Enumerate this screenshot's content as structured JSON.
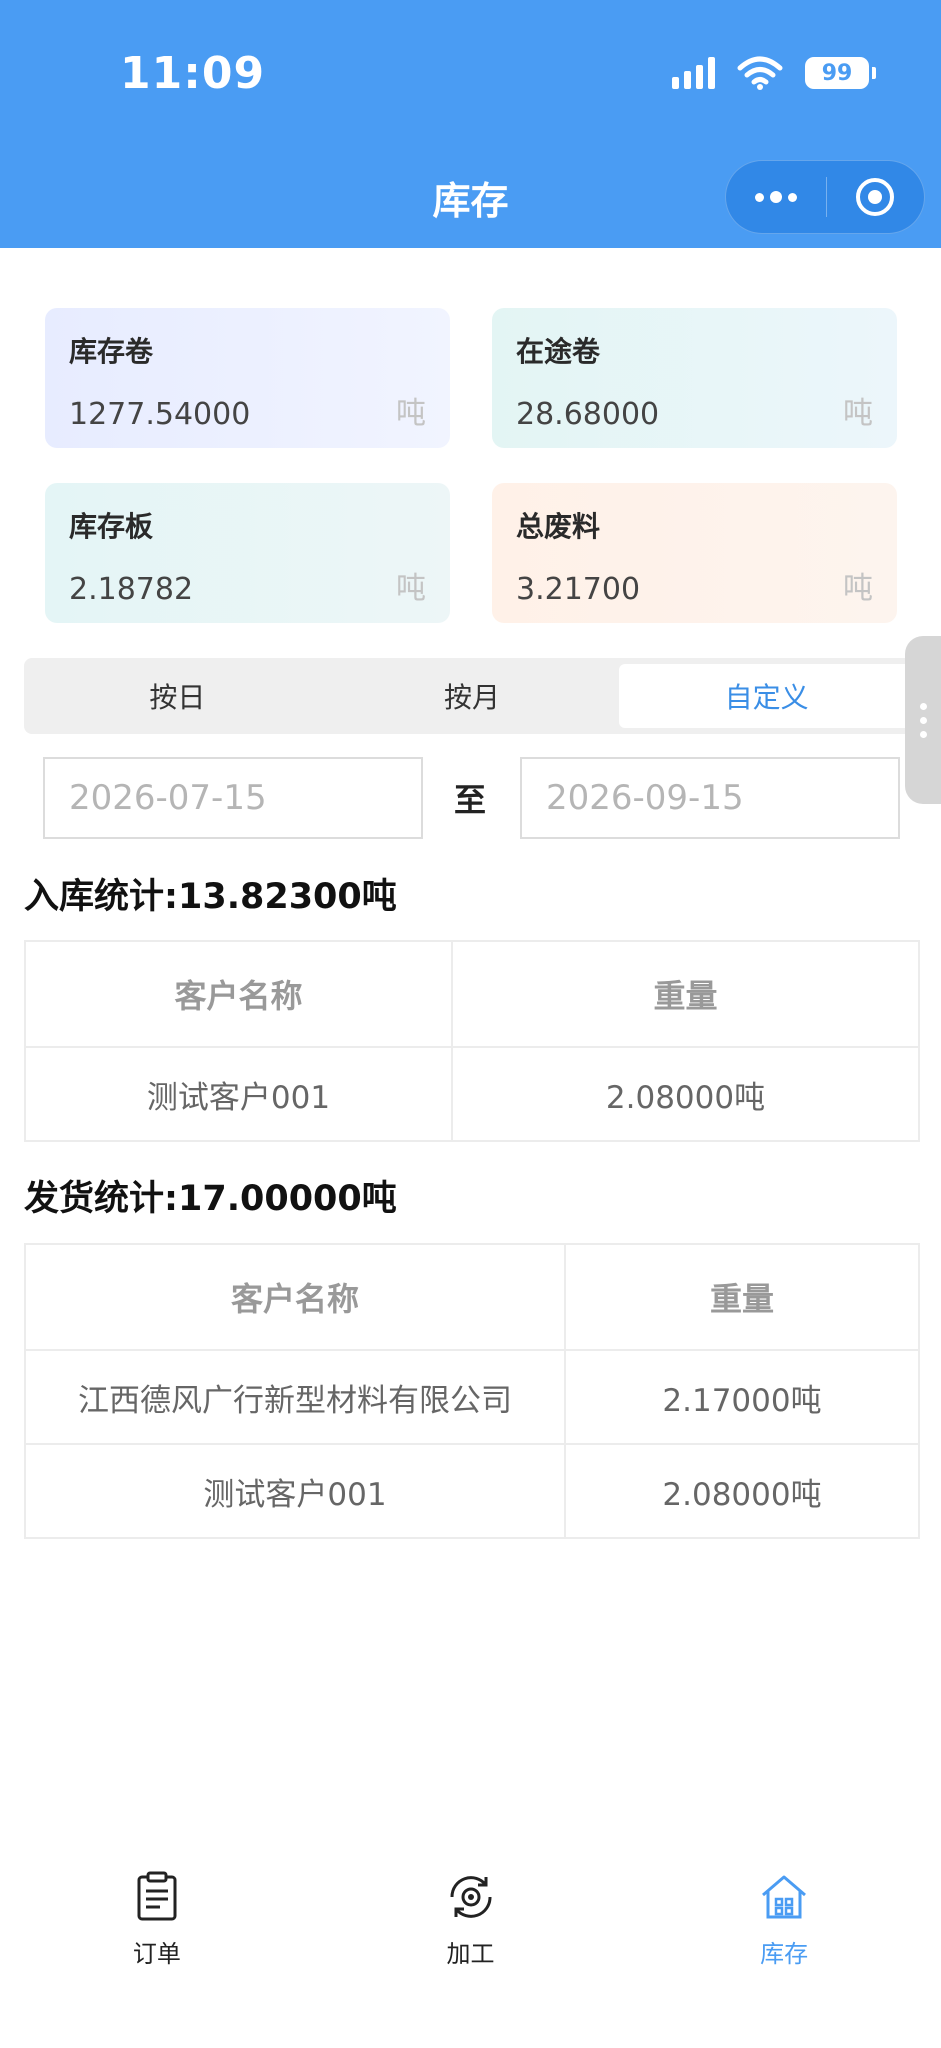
{
  "status_bar": {
    "time": "11:09",
    "battery": "99",
    "icons": [
      "signal-icon",
      "wifi-icon",
      "battery-icon"
    ]
  },
  "header": {
    "title": "库存",
    "capsule_icons": [
      "more-icon",
      "target-icon"
    ]
  },
  "summary_cards": [
    {
      "label": "库存卷",
      "value": "1277.54000",
      "unit": "吨"
    },
    {
      "label": "在途卷",
      "value": "28.68000",
      "unit": "吨"
    },
    {
      "label": "库存板",
      "value": "2.18782",
      "unit": "吨"
    },
    {
      "label": "总废料",
      "value": "3.21700",
      "unit": "吨"
    }
  ],
  "filter_tabs": {
    "items": [
      "按日",
      "按月",
      "自定义"
    ],
    "active": "自定义"
  },
  "date_range": {
    "start": "2026-07-15",
    "separator": "至",
    "end": "2026-09-15"
  },
  "inbound": {
    "title": "入库统计:13.82300吨",
    "headers": [
      "客户名称",
      "重量"
    ],
    "rows": [
      [
        "测试客户001",
        "2.08000吨"
      ]
    ]
  },
  "shipment": {
    "title": "发货统计:17.00000吨",
    "headers": [
      "客户名称",
      "重量"
    ],
    "rows": [
      [
        "江西德风广行新型材料有限公司",
        "2.17000吨"
      ],
      [
        "测试客户001",
        "2.08000吨"
      ]
    ]
  },
  "tabbar": {
    "items": [
      {
        "label": "订单",
        "icon": "clipboard-icon"
      },
      {
        "label": "加工",
        "icon": "gear-cycle-icon"
      },
      {
        "label": "库存",
        "icon": "house-icon"
      }
    ],
    "active": "库存",
    "accent": "#4a9cf3"
  },
  "colors": {
    "header_bg": "#4a9cf3",
    "active_tab": "#3a8ee6"
  }
}
